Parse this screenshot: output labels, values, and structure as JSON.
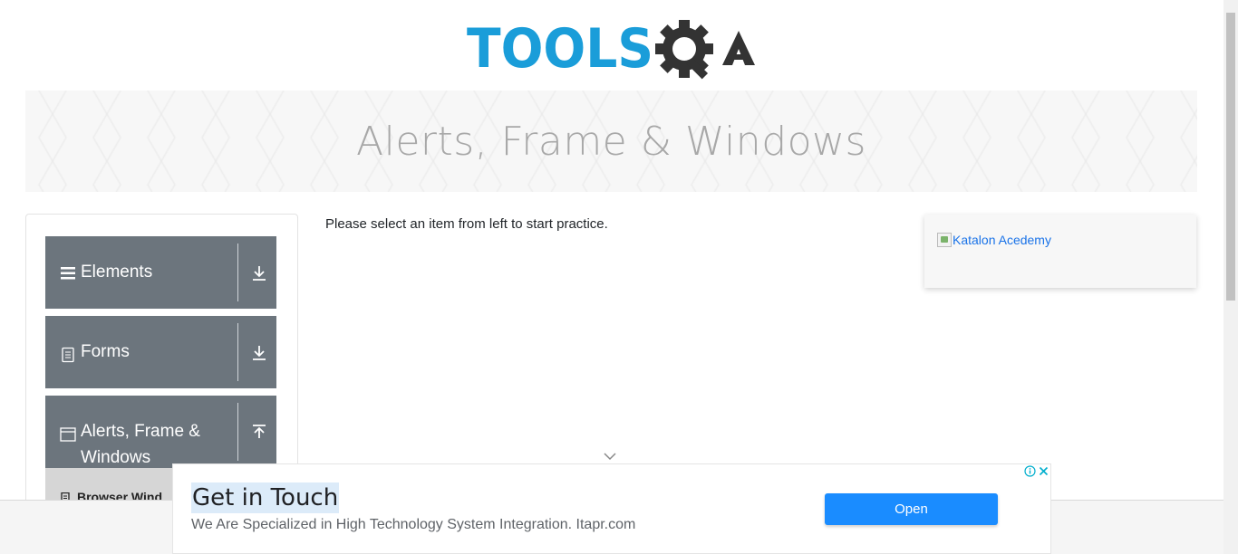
{
  "logo": {
    "text_tools": "TOOLS",
    "text_qa": "QA",
    "brand_blue": "#1a9dd9",
    "brand_dark": "#333333"
  },
  "banner": {
    "title": "Alerts, Frame & Windows"
  },
  "sidebar": {
    "groups": [
      {
        "label": "Elements",
        "icon": "hamburger-icon",
        "toggle": "download-arrow-icon"
      },
      {
        "label": "Forms",
        "icon": "document-icon",
        "toggle": "download-arrow-icon"
      },
      {
        "label": "Alerts, Frame &",
        "label2": "Windows",
        "icon": "window-icon",
        "toggle": "upload-arrow-icon"
      }
    ],
    "sub_item": {
      "label": "Browser Wind",
      "icon": "document-icon"
    },
    "group_color": "#6c757d"
  },
  "main": {
    "instruction": "Please select an item from left to start practice."
  },
  "side_ad": {
    "alt_text": "Katalon Acedemy"
  },
  "bottom_ad": {
    "title": "Get in Touch",
    "description": "We Are Specialized in High Technology System Integration. Itapr.com",
    "button_label": "Open",
    "button_color": "#1a8cff"
  }
}
